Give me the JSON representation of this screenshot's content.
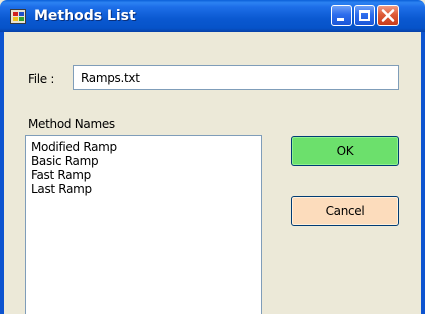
{
  "window": {
    "title": "Methods List"
  },
  "file": {
    "label": "File :",
    "value": "Ramps.txt"
  },
  "methods": {
    "label": "Method Names",
    "items": [
      "Modified Ramp",
      "Basic Ramp",
      "Fast Ramp",
      "Last Ramp"
    ]
  },
  "buttons": {
    "ok_label": "OK",
    "cancel_label": "Cancel"
  },
  "colors": {
    "titlebar": "#0a58d0",
    "ok_button": "#6ce06c",
    "cancel_button": "#fcdcbc",
    "dialog_background": "#ece9d8",
    "close_button": "#dd5b38"
  },
  "icons": {
    "app": "app-window-icon",
    "minimize": "minimize-icon",
    "maximize": "maximize-icon",
    "close": "close-icon"
  }
}
